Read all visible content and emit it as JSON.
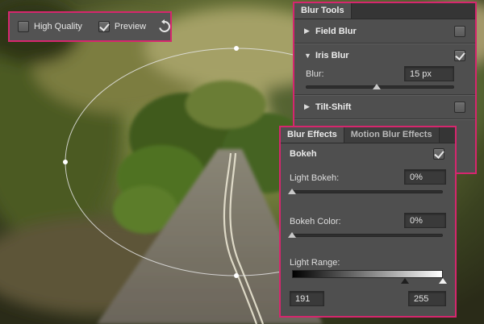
{
  "toolbar": {
    "high_quality_label": "High Quality",
    "high_quality_checked": false,
    "preview_label": "Preview",
    "preview_checked": true,
    "reset_icon": "rotate-ccw-icon"
  },
  "blur_tools": {
    "tab": "Blur Tools",
    "tools": [
      {
        "name": "Field Blur",
        "expanded": false,
        "checked": false
      },
      {
        "name": "Iris Blur",
        "expanded": true,
        "checked": true
      },
      {
        "name": "Tilt-Shift",
        "expanded": false,
        "checked": false
      }
    ],
    "iris_blur": {
      "blur_label": "Blur:",
      "blur_value": "15 px",
      "blur_slider": 0.48
    }
  },
  "blur_effects": {
    "tabs": [
      "Blur Effects",
      "Motion Blur Effects"
    ],
    "active_tab": 0,
    "bokeh_label": "Bokeh",
    "bokeh_checked": true,
    "light_bokeh_label": "Light Bokeh:",
    "light_bokeh_value": "0%",
    "light_bokeh_slider": 0,
    "bokeh_color_label": "Bokeh Color:",
    "bokeh_color_value": "0%",
    "bokeh_color_slider": 0,
    "light_range_label": "Light Range:",
    "light_range_low": "191",
    "light_range_high": "255",
    "light_range_low_fraction": 0.75,
    "light_range_high_fraction": 1.0
  },
  "colors": {
    "highlight": "#d6266e",
    "panel": "#4f4f4f"
  }
}
